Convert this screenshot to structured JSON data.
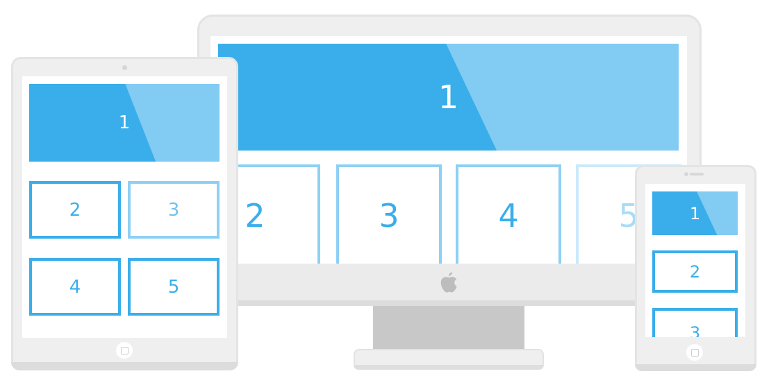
{
  "colors": {
    "primary": "#3aaeea",
    "light": "#82cbf3",
    "frame": "#efefef",
    "stand": "#c8c8c8"
  },
  "monitor": {
    "tiles": [
      "1",
      "2",
      "3",
      "4",
      "5"
    ],
    "logo_icon": "apple-logo-icon"
  },
  "tablet": {
    "tiles": [
      "1",
      "2",
      "3",
      "4",
      "5"
    ],
    "home_button_icon": "home-button-icon"
  },
  "phone": {
    "tiles": [
      "1",
      "2",
      "3"
    ],
    "home_button_icon": "home-button-icon"
  }
}
